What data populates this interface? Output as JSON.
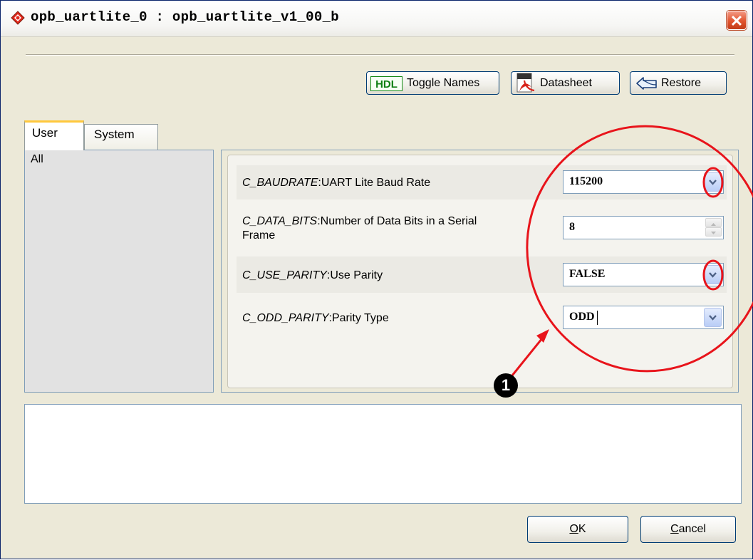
{
  "window": {
    "title": "opb_uartlite_0 : opb_uartlite_v1_00_b",
    "close_glyph": "✕"
  },
  "toolbar": {
    "hdl_badge": "HDL",
    "toggle_names_label": "Toggle Names",
    "datasheet_label": "Datasheet",
    "restore_label": "Restore"
  },
  "tabs": [
    {
      "label": "User",
      "selected": true
    },
    {
      "label": "System",
      "selected": false
    }
  ],
  "category": {
    "label": "All"
  },
  "params": [
    {
      "name": "C_BAUDRATE",
      "desc": "UART Lite Baud Rate",
      "value": "115200",
      "control": "dropdown"
    },
    {
      "name": "C_DATA_BITS",
      "desc": "Number of Data Bits in a Serial",
      "desc2": "Frame",
      "value": "8",
      "control": "spinner"
    },
    {
      "name": "C_USE_PARITY",
      "desc": "Use Parity",
      "value": "FALSE",
      "control": "dropdown"
    },
    {
      "name": "C_ODD_PARITY",
      "desc": "Parity Type",
      "value": "ODD",
      "control": "dropdown"
    }
  ],
  "buttons": {
    "ok_label": "K",
    "ok_mnemonic": "O",
    "cancel_label": "ancel",
    "cancel_mnemonic": "C"
  },
  "annotation": {
    "marker": "1"
  },
  "colors": {
    "annotation_red": "#e8141b",
    "dropdown_glyph": "#4d6185"
  },
  "icons": [
    "app-icon",
    "close-icon",
    "hdl-icon",
    "pdf-icon",
    "restore-icon",
    "dropdown-arrow-icon",
    "spinner-icon"
  ]
}
